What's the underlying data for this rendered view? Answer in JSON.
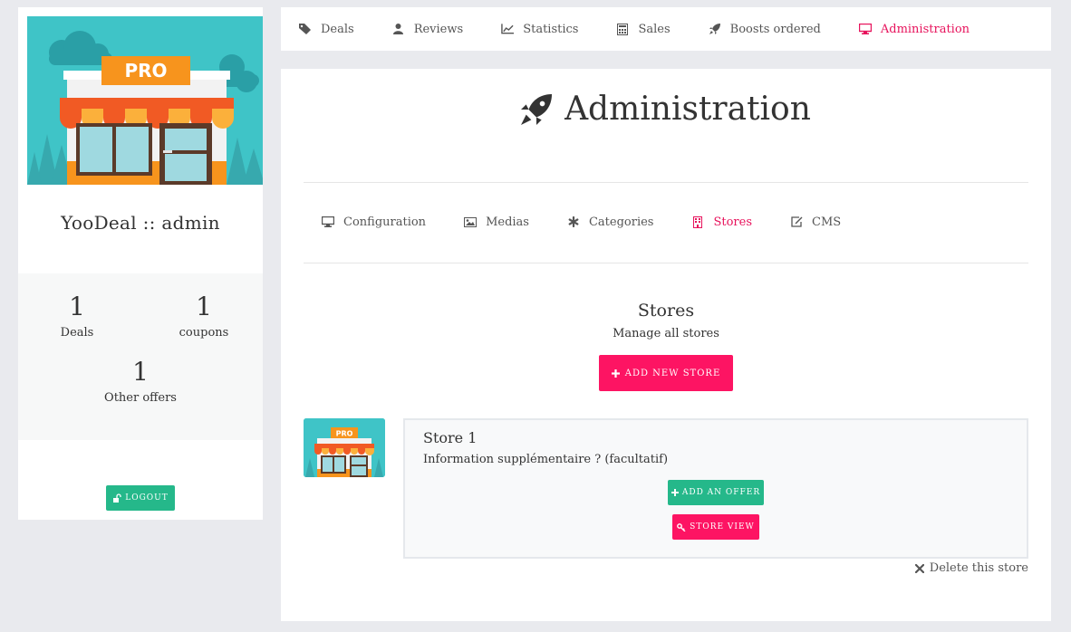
{
  "sidebar": {
    "hero_sign": "PRO",
    "user_name": "YooDeal :: admin",
    "stats": [
      {
        "value": "1",
        "label": "Deals"
      },
      {
        "value": "1",
        "label": "coupons"
      },
      {
        "value": "1",
        "label": "Other offers"
      }
    ],
    "logout_label": "LOGOUT"
  },
  "top_nav": {
    "items": [
      {
        "label": "Deals",
        "icon": "tags-icon"
      },
      {
        "label": "Reviews",
        "icon": "user-icon"
      },
      {
        "label": "Statistics",
        "icon": "line-chart-icon"
      },
      {
        "label": "Sales",
        "icon": "calculator-icon"
      },
      {
        "label": "Boosts ordered",
        "icon": "rocket-icon"
      },
      {
        "label": "Administration",
        "icon": "desktop-icon",
        "active": true
      }
    ]
  },
  "main": {
    "title": "Administration",
    "sub_nav": [
      {
        "label": "Configuration",
        "icon": "desktop-icon"
      },
      {
        "label": "Medias",
        "icon": "image-icon"
      },
      {
        "label": "Categories",
        "icon": "asterisk-icon"
      },
      {
        "label": "Stores",
        "icon": "building-icon",
        "active": true
      },
      {
        "label": "CMS",
        "icon": "edit-icon"
      }
    ],
    "section_title": "Stores",
    "section_subtitle": "Manage all stores",
    "add_store_label": "ADD NEW STORE",
    "store": {
      "thumb_sign": "PRO",
      "name": "Store 1",
      "info": "Information supplémentaire ? (facultatif)",
      "add_offer_label": "ADD AN OFFER",
      "store_view_label": "STORE VIEW",
      "delete_label": "Delete this store"
    }
  },
  "colors": {
    "accent_pink": "#fd1463",
    "active_pink": "#e7135c",
    "green": "#25b88a",
    "hero_teal": "#3fc4c7",
    "background": "#e9eaee"
  }
}
